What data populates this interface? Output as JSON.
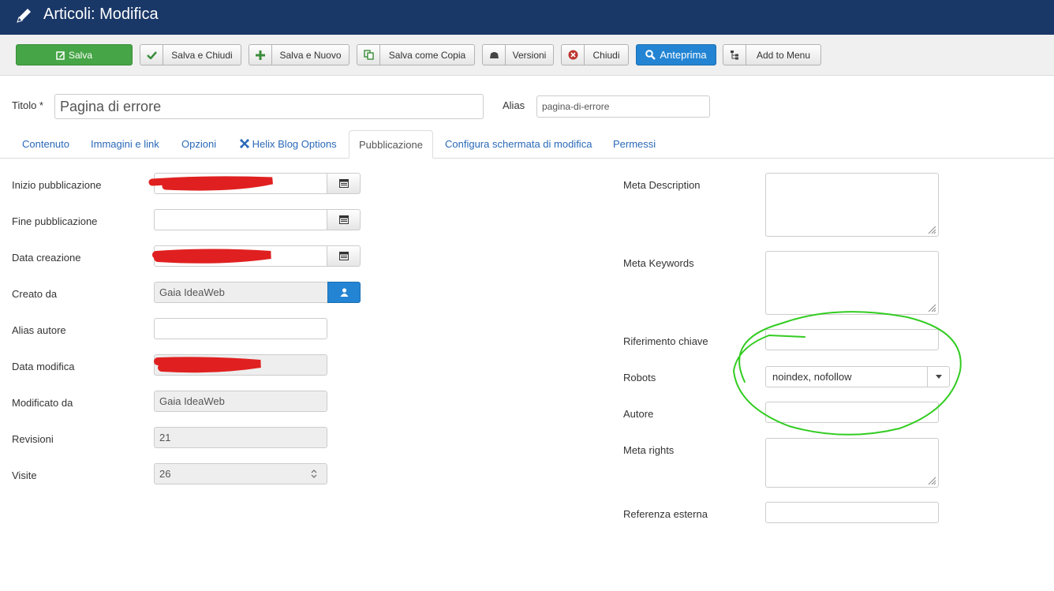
{
  "header": {
    "title": "Articoli: Modifica",
    "icon": "pencil-icon"
  },
  "toolbar": {
    "save": "Salva",
    "save_close": "Salva e Chiudi",
    "save_new": "Salva e Nuovo",
    "save_copy": "Salva come Copia",
    "versions": "Versioni",
    "close": "Chiudi",
    "preview": "Anteprima",
    "add_menu": "Add to Menu"
  },
  "form": {
    "title_label": "Titolo *",
    "title_value": "Pagina di errore",
    "alias_label": "Alias",
    "alias_value": "pagina-di-errore"
  },
  "tabs": [
    "Contenuto",
    "Immagini e link",
    "Opzioni",
    "Helix Blog Options",
    "Pubblicazione",
    "Configura schermata di modifica",
    "Permessi"
  ],
  "publishing": {
    "start_label": "Inizio pubblicazione",
    "finish_label": "Fine pubblicazione",
    "created_label": "Data creazione",
    "created_by_label": "Creato da",
    "created_by_value": "Gaia IdeaWeb",
    "author_alias_label": "Alias autore",
    "modified_label": "Data modifica",
    "modified_by_label": "Modificato da",
    "modified_by_value": "Gaia IdeaWeb",
    "revisions_label": "Revisioni",
    "revisions_value": "21",
    "hits_label": "Visite",
    "hits_value": "26"
  },
  "metadata": {
    "description_label": "Meta Description",
    "keywords_label": "Meta Keywords",
    "key_ref_label": "Riferimento chiave",
    "robots_label": "Robots",
    "robots_value": "noindex, nofollow",
    "author_label": "Autore",
    "rights_label": "Meta rights",
    "xreference_label": "Referenza esterna"
  },
  "colors": {
    "header_bg": "#1a3867",
    "save_green": "#46a546",
    "preview_blue": "#2384d3",
    "redaction_red": "#e02020",
    "annotation_green": "#33cc22"
  }
}
